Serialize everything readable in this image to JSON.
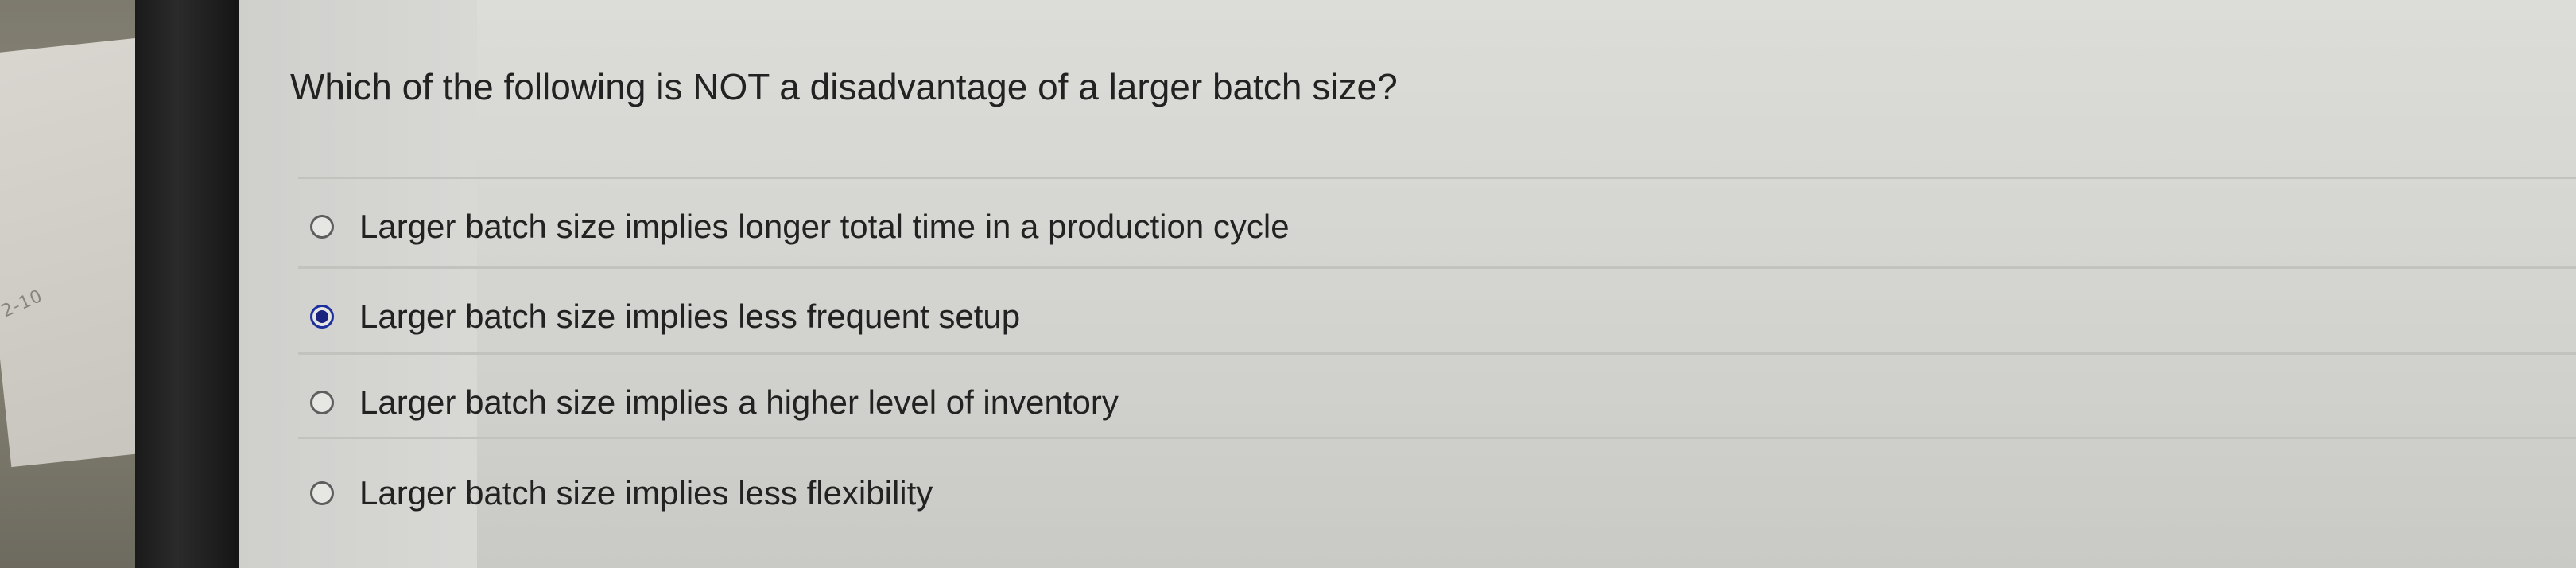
{
  "question": {
    "text": "Which of the following is NOT a disadvantage of a larger batch size?"
  },
  "options": [
    {
      "label": "Larger batch size implies longer total time in a production cycle",
      "selected": false
    },
    {
      "label": "Larger batch size implies less frequent setup",
      "selected": true
    },
    {
      "label": "Larger batch size implies a higher level of inventory",
      "selected": false
    },
    {
      "label": "Larger batch size implies less flexibility",
      "selected": false
    }
  ],
  "background": {
    "paper_note": "2-10"
  }
}
